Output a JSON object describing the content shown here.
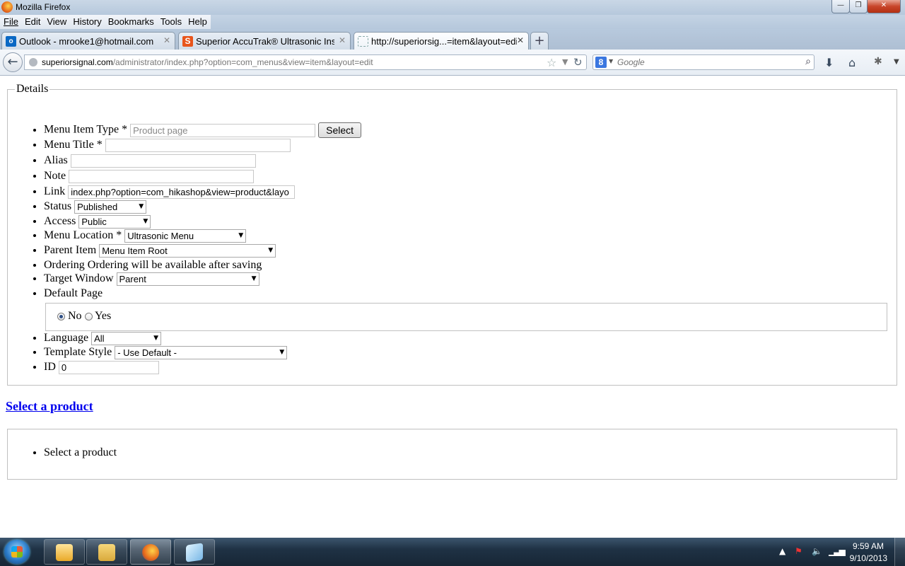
{
  "window": {
    "title": "Mozilla Firefox",
    "min": "—",
    "max": "❐",
    "close": "✕"
  },
  "menu": [
    "File",
    "Edit",
    "View",
    "History",
    "Bookmarks",
    "Tools",
    "Help"
  ],
  "tabs": [
    {
      "label": "Outlook - mrooke1@hotmail.com",
      "icon": "o"
    },
    {
      "label": "Superior AccuTrak® Ultrasonic Instru...",
      "icon": "S"
    },
    {
      "label": "http://superiorsig...=item&layout=edit",
      "icon": ""
    }
  ],
  "new_tab": "+",
  "urlbar": {
    "domain": "superiorsignal.com",
    "path": "/administrator/index.php?option=com_menus&view=item&layout=edit"
  },
  "search": {
    "engine_letter": "8",
    "placeholder": "Google"
  },
  "details": {
    "legend": "Details",
    "menu_item_type_label": "Menu Item Type *",
    "menu_item_type_value": "Product page",
    "select_button": "Select",
    "menu_title_label": "Menu Title *",
    "menu_title_value": "",
    "alias_label": "Alias",
    "alias_value": "",
    "note_label": "Note",
    "note_value": "",
    "link_label": "Link",
    "link_value": "index.php?option=com_hikashop&view=product&layo",
    "status_label": "Status",
    "status_value": "Published",
    "access_label": "Access",
    "access_value": "Public",
    "menu_location_label": "Menu Location *",
    "menu_location_value": "Ultrasonic Menu",
    "parent_item_label": "Parent Item",
    "parent_item_value": "Menu Item Root",
    "ordering_text": "Ordering Ordering will be available after saving",
    "target_window_label": "Target Window",
    "target_window_value": "Parent",
    "default_page_label": "Default Page",
    "default_no": "No",
    "default_yes": "Yes",
    "language_label": "Language",
    "language_value": "All",
    "template_style_label": "Template Style",
    "template_style_value": "- Use Default -",
    "id_label": "ID",
    "id_value": "0"
  },
  "product": {
    "link": "Select a product",
    "item": "Select a product"
  },
  "taskbar": {
    "time": "9:59 AM",
    "date": "9/10/2013"
  }
}
